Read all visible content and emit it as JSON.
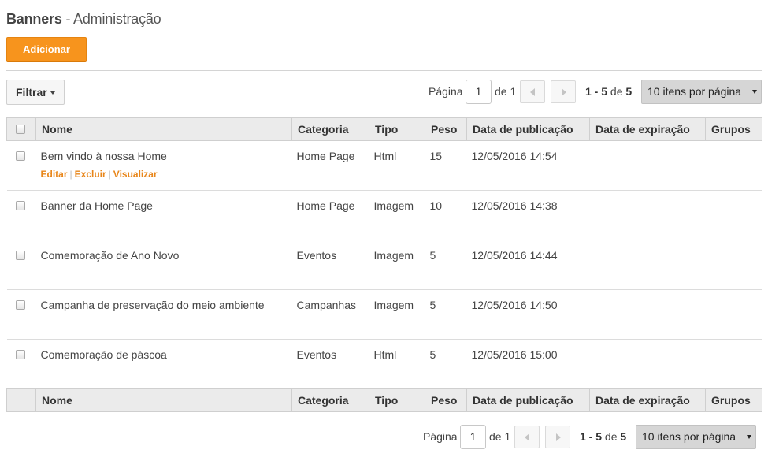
{
  "header": {
    "title_bold": "Banners",
    "title_rest": " - Administração",
    "add_label": "Adicionar"
  },
  "filter": {
    "label": "Filtrar"
  },
  "pager": {
    "pagina_label": "Página",
    "page_value": "1",
    "de_total": "de 1",
    "range": "1 - 5",
    "de_word": "de",
    "total": "5",
    "per_page": "10 itens por página"
  },
  "table": {
    "columns": [
      "Nome",
      "Categoria",
      "Tipo",
      "Peso",
      "Data de publicação",
      "Data de expiração",
      "Grupos"
    ],
    "rows": [
      {
        "nome": "Bem vindo à nossa Home",
        "categoria": "Home Page",
        "tipo": "Html",
        "peso": "15",
        "publicacao": "12/05/2016 14:54",
        "expiracao": "",
        "grupos": ""
      },
      {
        "nome": "Banner da Home Page",
        "categoria": "Home Page",
        "tipo": "Imagem",
        "peso": "10",
        "publicacao": "12/05/2016 14:38",
        "expiracao": "",
        "grupos": ""
      },
      {
        "nome": "Comemoração de Ano Novo",
        "categoria": "Eventos",
        "tipo": "Imagem",
        "peso": "5",
        "publicacao": "12/05/2016 14:44",
        "expiracao": "",
        "grupos": ""
      },
      {
        "nome": "Campanha de preservação do meio ambiente",
        "categoria": "Campanhas",
        "tipo": "Imagem",
        "peso": "5",
        "publicacao": "12/05/2016 14:50",
        "expiracao": "",
        "grupos": ""
      },
      {
        "nome": "Comemoração de páscoa",
        "categoria": "Eventos",
        "tipo": "Html",
        "peso": "5",
        "publicacao": "12/05/2016 15:00",
        "expiracao": "",
        "grupos": ""
      }
    ],
    "row_actions": {
      "edit": "Editar",
      "delete": "Excluir",
      "view": "Visualizar",
      "separator": "|"
    }
  },
  "colors": {
    "accent": "#f7941d",
    "link": "#e8861a",
    "header_bg": "#ebebeb"
  }
}
